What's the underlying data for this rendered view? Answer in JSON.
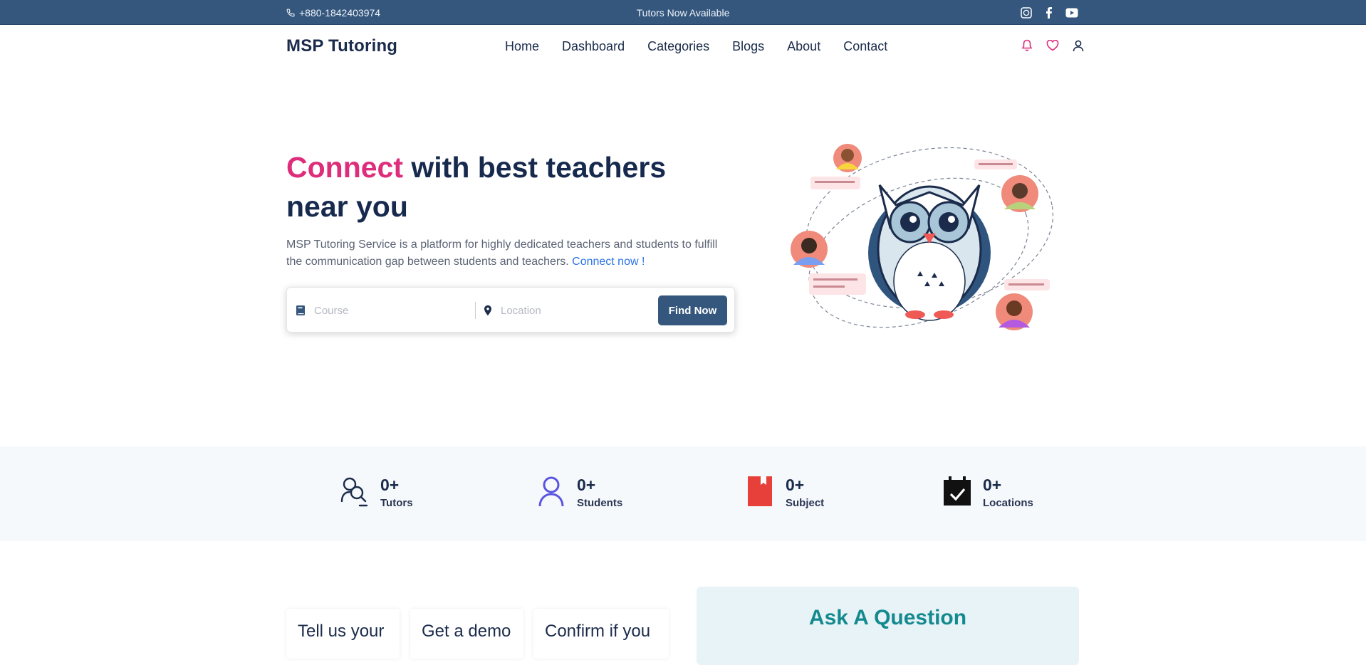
{
  "topbar": {
    "phone": "+880-1842403974",
    "announcement": "Tutors Now Available",
    "socials": [
      "whatsapp-icon",
      "facebook-icon",
      "youtube-icon"
    ]
  },
  "nav": {
    "brand": "MSP Tutoring",
    "items": [
      {
        "label": "Home"
      },
      {
        "label": "Dashboard"
      },
      {
        "label": "Categories"
      },
      {
        "label": "Blogs"
      },
      {
        "label": "About"
      },
      {
        "label": "Contact"
      }
    ],
    "icons": [
      "bell-icon",
      "heart-icon",
      "user-icon"
    ]
  },
  "hero": {
    "title_accent": "Connect",
    "title_rest": " with best teachers near you",
    "description": "MSP Tutoring Service is a platform for highly dedicated teachers and students to fulfill the communication gap between students and teachers. ",
    "description_link": "Connect now !",
    "search": {
      "course_placeholder": "Course",
      "location_placeholder": "Location",
      "button": "Find Now"
    }
  },
  "stats": [
    {
      "value": "0+",
      "label": "Tutors",
      "icon": "tutor-icon"
    },
    {
      "value": "0+",
      "label": "Students",
      "icon": "student-icon"
    },
    {
      "value": "0+",
      "label": "Subject",
      "icon": "book-icon"
    },
    {
      "value": "0+",
      "label": "Locations",
      "icon": "calendar-check-icon"
    }
  ],
  "cards": [
    {
      "title": "Tell us your"
    },
    {
      "title": "Get a demo"
    },
    {
      "title": "Confirm if you"
    }
  ],
  "ask": {
    "title": "Ask A Question"
  },
  "colors": {
    "primary": "#35577e",
    "accent": "#de2d7a",
    "link": "#2c74e8",
    "teal": "#148a8f"
  }
}
